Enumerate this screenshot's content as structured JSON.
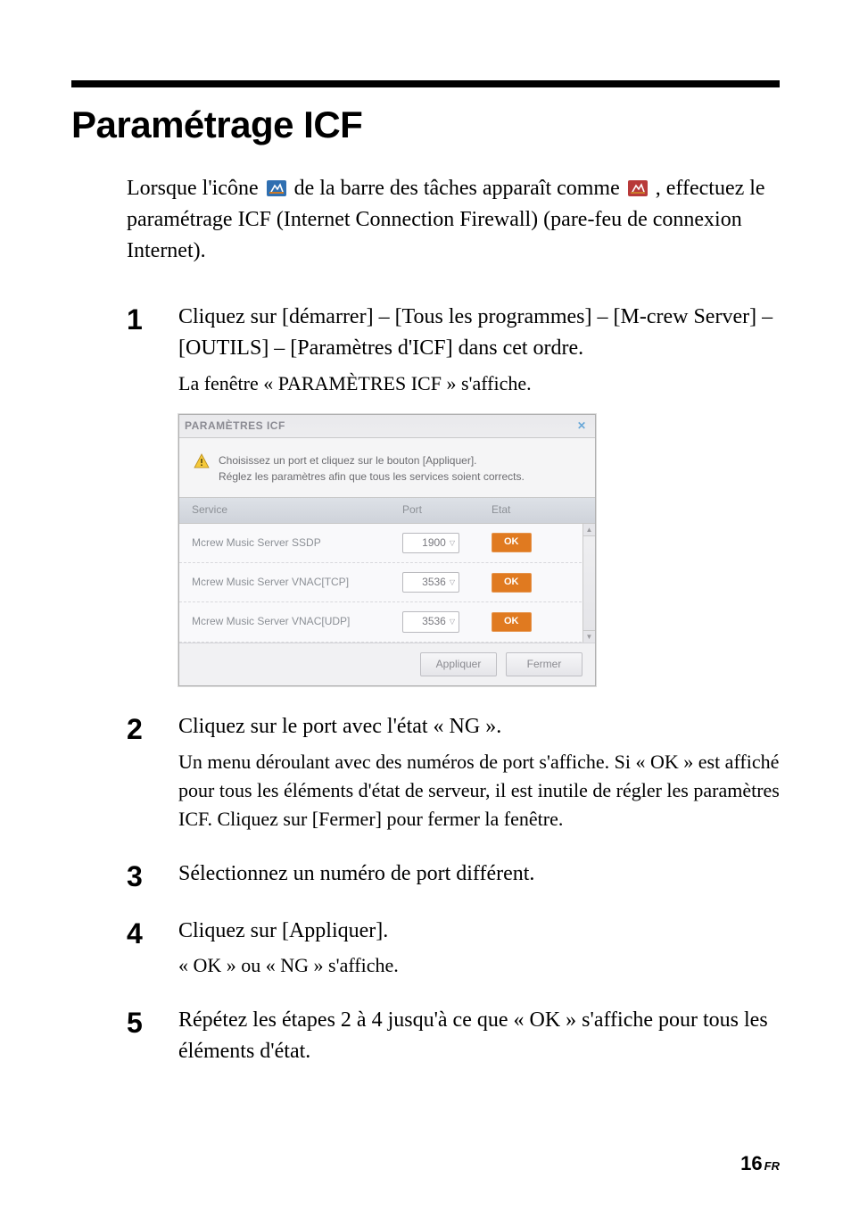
{
  "title": "Paramétrage ICF",
  "intro": {
    "p1a": "Lorsque l'icône ",
    "p1b": " de la barre des tâches apparaît comme ",
    "p1c": ", effectuez le paramétrage ICF (Internet Connection Firewall) (pare-feu de connexion Internet).",
    "icon1_fill": "#2f6fb1",
    "icon2_fill": "#b83a3a"
  },
  "steps": {
    "s1": {
      "num": "1",
      "main": "Cliquez sur [démarrer] – [Tous les programmes] – [M-crew Server] – [OUTILS] – [Paramètres d'ICF] dans cet ordre.",
      "sub": "La fenêtre « PARAMÈTRES ICF » s'affiche."
    },
    "s2": {
      "num": "2",
      "main": "Cliquez sur le port avec l'état « NG ».",
      "sub": "Un menu déroulant avec des numéros de port s'affiche. Si « OK » est affiché pour tous les éléments d'état de serveur, il est inutile de régler les paramètres ICF. Cliquez sur [Fermer] pour fermer la fenêtre."
    },
    "s3": {
      "num": "3",
      "main": "Sélectionnez un numéro de port différent."
    },
    "s4": {
      "num": "4",
      "main": "Cliquez sur [Appliquer].",
      "sub": "« OK » ou « NG » s'affiche."
    },
    "s5": {
      "num": "5",
      "main": "Répétez les étapes 2 à 4 jusqu'à ce que « OK » s'affiche pour tous les éléments d'état."
    }
  },
  "dialog": {
    "title": "PARAMÈTRES ICF",
    "msg_line1": "Choisissez un port et cliquez sur le bouton [Appliquer].",
    "msg_line2": "Réglez les paramètres afin que tous les services soient corrects.",
    "col_service": "Service",
    "col_port": "Port",
    "col_state": "Etat",
    "rows": [
      {
        "service": "Mcrew Music Server SSDP",
        "port": "1900",
        "state": "OK"
      },
      {
        "service": "Mcrew Music Server VNAC[TCP]",
        "port": "3536",
        "state": "OK"
      },
      {
        "service": "Mcrew Music Server VNAC[UDP]",
        "port": "3536",
        "state": "OK"
      }
    ],
    "apply": "Appliquer",
    "close": "Fermer"
  },
  "page_number": "16",
  "page_lang": "FR"
}
